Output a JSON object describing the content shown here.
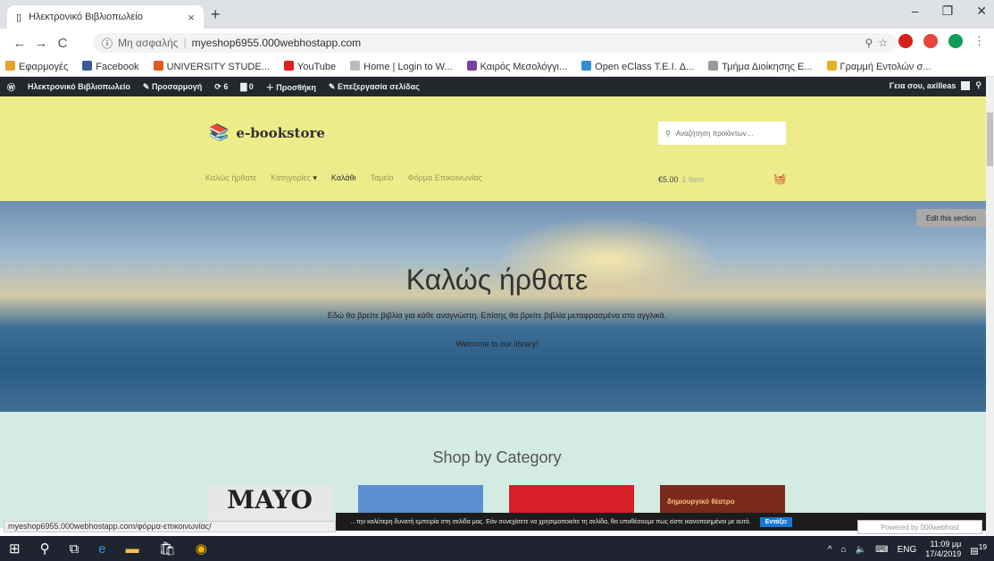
{
  "browser": {
    "tab_title": "Ηλεκτρονικό Βιβλιοπωλείο",
    "address_security": "Μη ασφαλής",
    "address_url": "myeshop6955.000webhostapp.com",
    "bookmarks": [
      {
        "label": "Εφαρμογές",
        "color": "#e8a12b"
      },
      {
        "label": "Facebook",
        "color": "#3b5998"
      },
      {
        "label": "UNIVERSITY STUDE...",
        "color": "#e35a1b"
      },
      {
        "label": "YouTube",
        "color": "#e02020"
      },
      {
        "label": "Home | Login to W...",
        "color": "#bbbbbb"
      },
      {
        "label": "Καιρός Μεσολόγγι...",
        "color": "#7a3ea0"
      },
      {
        "label": "Open eClass T.E.I. Δ...",
        "color": "#2f8fd1"
      },
      {
        "label": "Τμήμα Διοίκησης Ε...",
        "color": "#999999"
      },
      {
        "label": "Γραμμή Εντολών σ...",
        "color": "#e8b020"
      }
    ]
  },
  "wpbar": {
    "site": "Ηλεκτρονικό Βιβλιοπωλείο",
    "customize": "Προσαρμογή",
    "updates": "6",
    "comments": "0",
    "new": "Προσθήκη",
    "edit_page": "Επεξεργασία σελίδας",
    "greeting": "Γεια σου, axilleas"
  },
  "site": {
    "logo": "e-bookstore",
    "search_placeholder": "Αναζήτηση προϊόντων…",
    "nav": [
      "Καλώς ήρθατε",
      "Κατηγορίες",
      "Καλάθι",
      "Ταμείο",
      "Φόρμα Επικοινωνίας"
    ],
    "cart_total": "€5.00",
    "cart_items": "1 item"
  },
  "hero": {
    "edit_label": "Edit this section",
    "title": "Καλώς ήρθατε",
    "subtitle": "Εδώ θα βρείτε βιβλία για κάθε αναγνώστη. Επίσης θα βρείτε βιβλία μεταφρασμένα στα αγγλικά.",
    "welcome": "Welcome to our library!"
  },
  "category": {
    "heading": "Shop by Category",
    "books": [
      {
        "label": "MAYO",
        "color": "#e7e7e7"
      },
      {
        "label": "",
        "color": "#5b8fd0"
      },
      {
        "label": "",
        "color": "#d61f26"
      },
      {
        "label": "δημιουργικό θέατρο",
        "color": "#7a2a1c"
      }
    ]
  },
  "status_url": "myeshop6955.000webhostapp.com/φόρμα-επικοινωνίας/",
  "cookie": {
    "text": "…την καλύτερη δυνατή εμπειρία στη σελίδα μας. Εάν συνεχίσετε να χρησιμοποιείτε τη σελίδα, θα υποθέσουμε πως είστε ικανοποιημένοι με αυτό.",
    "button": "Εντάξει"
  },
  "powered": "Powered by 000webhost",
  "taskbar": {
    "lang": "ENG",
    "time": "11:09 μμ",
    "date": "17/4/2019",
    "notif": "19"
  }
}
